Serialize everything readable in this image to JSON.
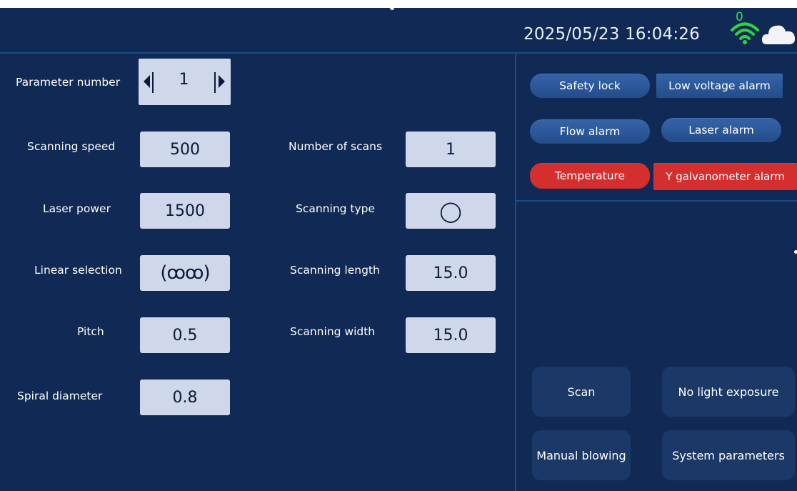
{
  "header": {
    "datetime": "2025/05/23 16:04:26",
    "wifi_count": "0",
    "icons": [
      "wifi-icon",
      "cloud-icon"
    ],
    "wifi_color": "#2fd341"
  },
  "parameter": {
    "label": "Parameter number",
    "value": "1"
  },
  "left_fields": [
    {
      "label": "Scanning speed",
      "value": "500"
    },
    {
      "label": "Laser power",
      "value": "1500"
    },
    {
      "label": "Linear selection",
      "value": "(ꝏꝏ)"
    },
    {
      "label": "Pitch",
      "value": "0.5"
    },
    {
      "label": "Spiral diameter",
      "value": "0.8"
    }
  ],
  "right_fields": [
    {
      "label": "Number of scans",
      "value": "1"
    },
    {
      "label": "Scanning type",
      "value": "◯"
    },
    {
      "label": "Scanning length",
      "value": "15.0"
    },
    {
      "label": "Scanning width",
      "value": "15.0"
    }
  ],
  "alarms": [
    {
      "label": "Safety lock",
      "state": "normal"
    },
    {
      "label": "Low voltage alarm",
      "state": "normal"
    },
    {
      "label": "Flow alarm",
      "state": "normal"
    },
    {
      "label": "Laser alarm",
      "state": "normal"
    },
    {
      "label": "Temperature",
      "state": "active"
    },
    {
      "label": "Y galvanometer alarm",
      "state": "active"
    }
  ],
  "actions": {
    "scan": "Scan",
    "no_light": "No light exposure",
    "manual_blowing": "Manual blowing",
    "system_parameters": "System parameters"
  },
  "colors": {
    "background": "#102a55",
    "alarm_normal": "#2c5a9c",
    "alarm_active": "#d52e2e",
    "field_bg": "#cfd8ea"
  }
}
